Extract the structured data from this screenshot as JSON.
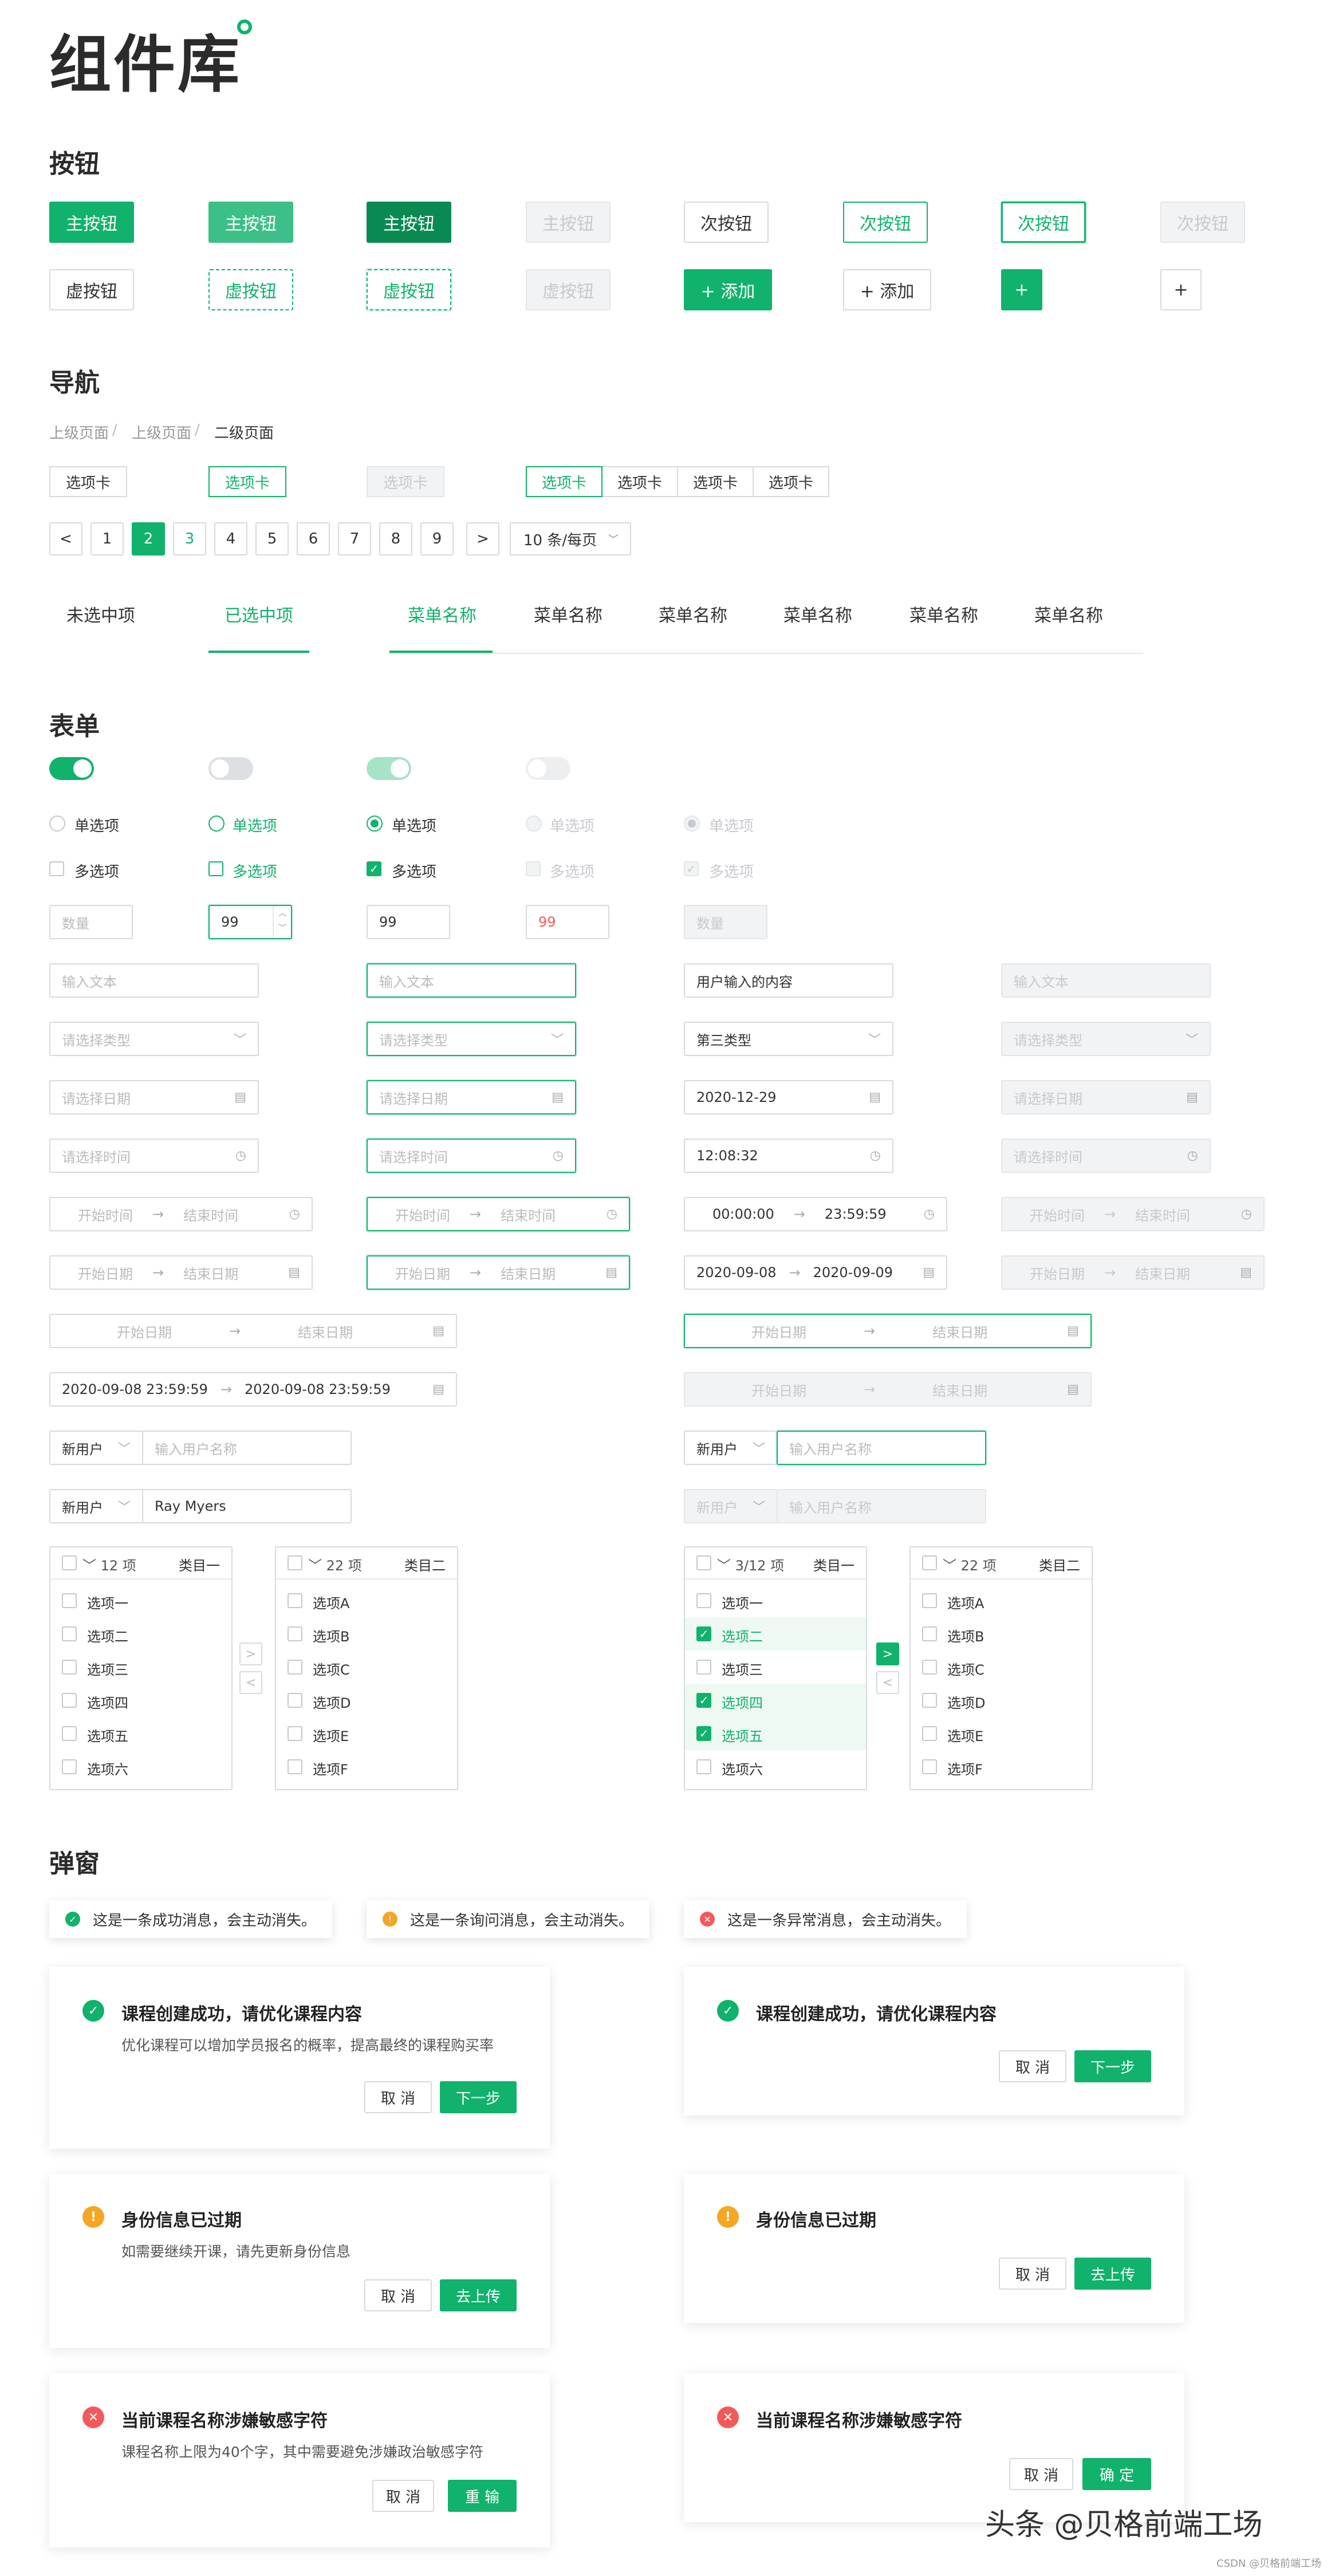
{
  "title": "组件库",
  "sections": {
    "buttons": "按钮",
    "nav": "导航",
    "form": "表单",
    "popup": "弹窗"
  },
  "buttons": {
    "row1": [
      "主按钮",
      "主按钮",
      "主按钮",
      "主按钮",
      "次按钮",
      "次按钮",
      "次按钮",
      "次按钮"
    ],
    "row2": [
      "虚按钮",
      "虚按钮",
      "虚按钮",
      "虚按钮",
      "+ 添加",
      "+ 添加",
      "+",
      "+"
    ]
  },
  "breadcrumb": {
    "items": [
      "上级页面",
      "上级页面",
      "二级页面"
    ],
    "sep": "/"
  },
  "tabs_single": [
    "选项卡",
    "选项卡",
    "选项卡"
  ],
  "tabs_group": [
    "选项卡",
    "选项卡",
    "选项卡",
    "选项卡"
  ],
  "pagination": {
    "prev": "<",
    "next": ">",
    "pages": [
      "1",
      "2",
      "3",
      "4",
      "5",
      "6",
      "7",
      "8",
      "9"
    ],
    "current": "2",
    "page_size": "10 条/每页"
  },
  "menu": {
    "items": [
      "未选中项",
      "已选中项",
      "菜单名称",
      "菜单名称",
      "菜单名称",
      "菜单名称",
      "菜单名称",
      "菜单名称"
    ]
  },
  "radio_label": "单选项",
  "checkbox_label": "多选项",
  "number": {
    "placeholder": "数量",
    "value": "99"
  },
  "text_input": {
    "placeholder": "输入文本",
    "value": "用户输入的内容"
  },
  "select": {
    "placeholder": "请选择类型",
    "value": "第三类型"
  },
  "date": {
    "placeholder": "请选择日期",
    "value": "2020-12-29"
  },
  "time": {
    "placeholder": "请选择时间",
    "value": "12:08:32"
  },
  "time_range": {
    "start": "开始时间",
    "end": "结束时间",
    "v_start": "00:00:00",
    "v_end": "23:59:59"
  },
  "date_range": {
    "start": "开始日期",
    "end": "结束日期",
    "v_start": "2020-09-08",
    "v_end": "2020-09-09"
  },
  "datetime_range": {
    "start": "开始日期",
    "end": "结束日期",
    "v_start": "2020-09-08 23:59:59",
    "v_end": "2020-09-08 23:59:59"
  },
  "user_select": {
    "prefix": "新用户",
    "placeholder": "输入用户名称",
    "value": "Ray Myers"
  },
  "transfer": {
    "left_count": "12 项",
    "left_count_sel": "3/12 项",
    "left_title": "类目一",
    "right_count": "22 项",
    "right_title": "类目二",
    "left_items": [
      "选项一",
      "选项二",
      "选项三",
      "选项四",
      "选项五",
      "选项六"
    ],
    "right_items": [
      "选项A",
      "选项B",
      "选项C",
      "选项D",
      "选项E",
      "选项F"
    ]
  },
  "toasts": {
    "success": "这是一条成功消息，会主动消失。",
    "warning": "这是一条询问消息，会主动消失。",
    "error": "这是一条异常消息，会主动消失。"
  },
  "dialogs": {
    "success_title": "课程创建成功，请优化课程内容",
    "success_desc": "优化课程可以增加学员报名的概率，提高最终的课程购买率",
    "warn_title": "身份信息已过期",
    "warn_desc": "如需要继续开课，请先更新身份信息",
    "error_title": "当前课程名称涉嫌敏感字符",
    "error_desc": "课程名称上限为40个字，其中需要避免涉嫌政治敏感字符",
    "cancel": "取 消",
    "next": "下一步",
    "upload": "去上传",
    "reinput": "重 输",
    "confirm": "确 定"
  },
  "watermark": {
    "main": "头条 @贝格前端工场",
    "sub": "CSDN @贝格前端工场"
  },
  "colors": {
    "primary": "#10b26c",
    "warning": "#f5a623",
    "error": "#f25a5a"
  }
}
